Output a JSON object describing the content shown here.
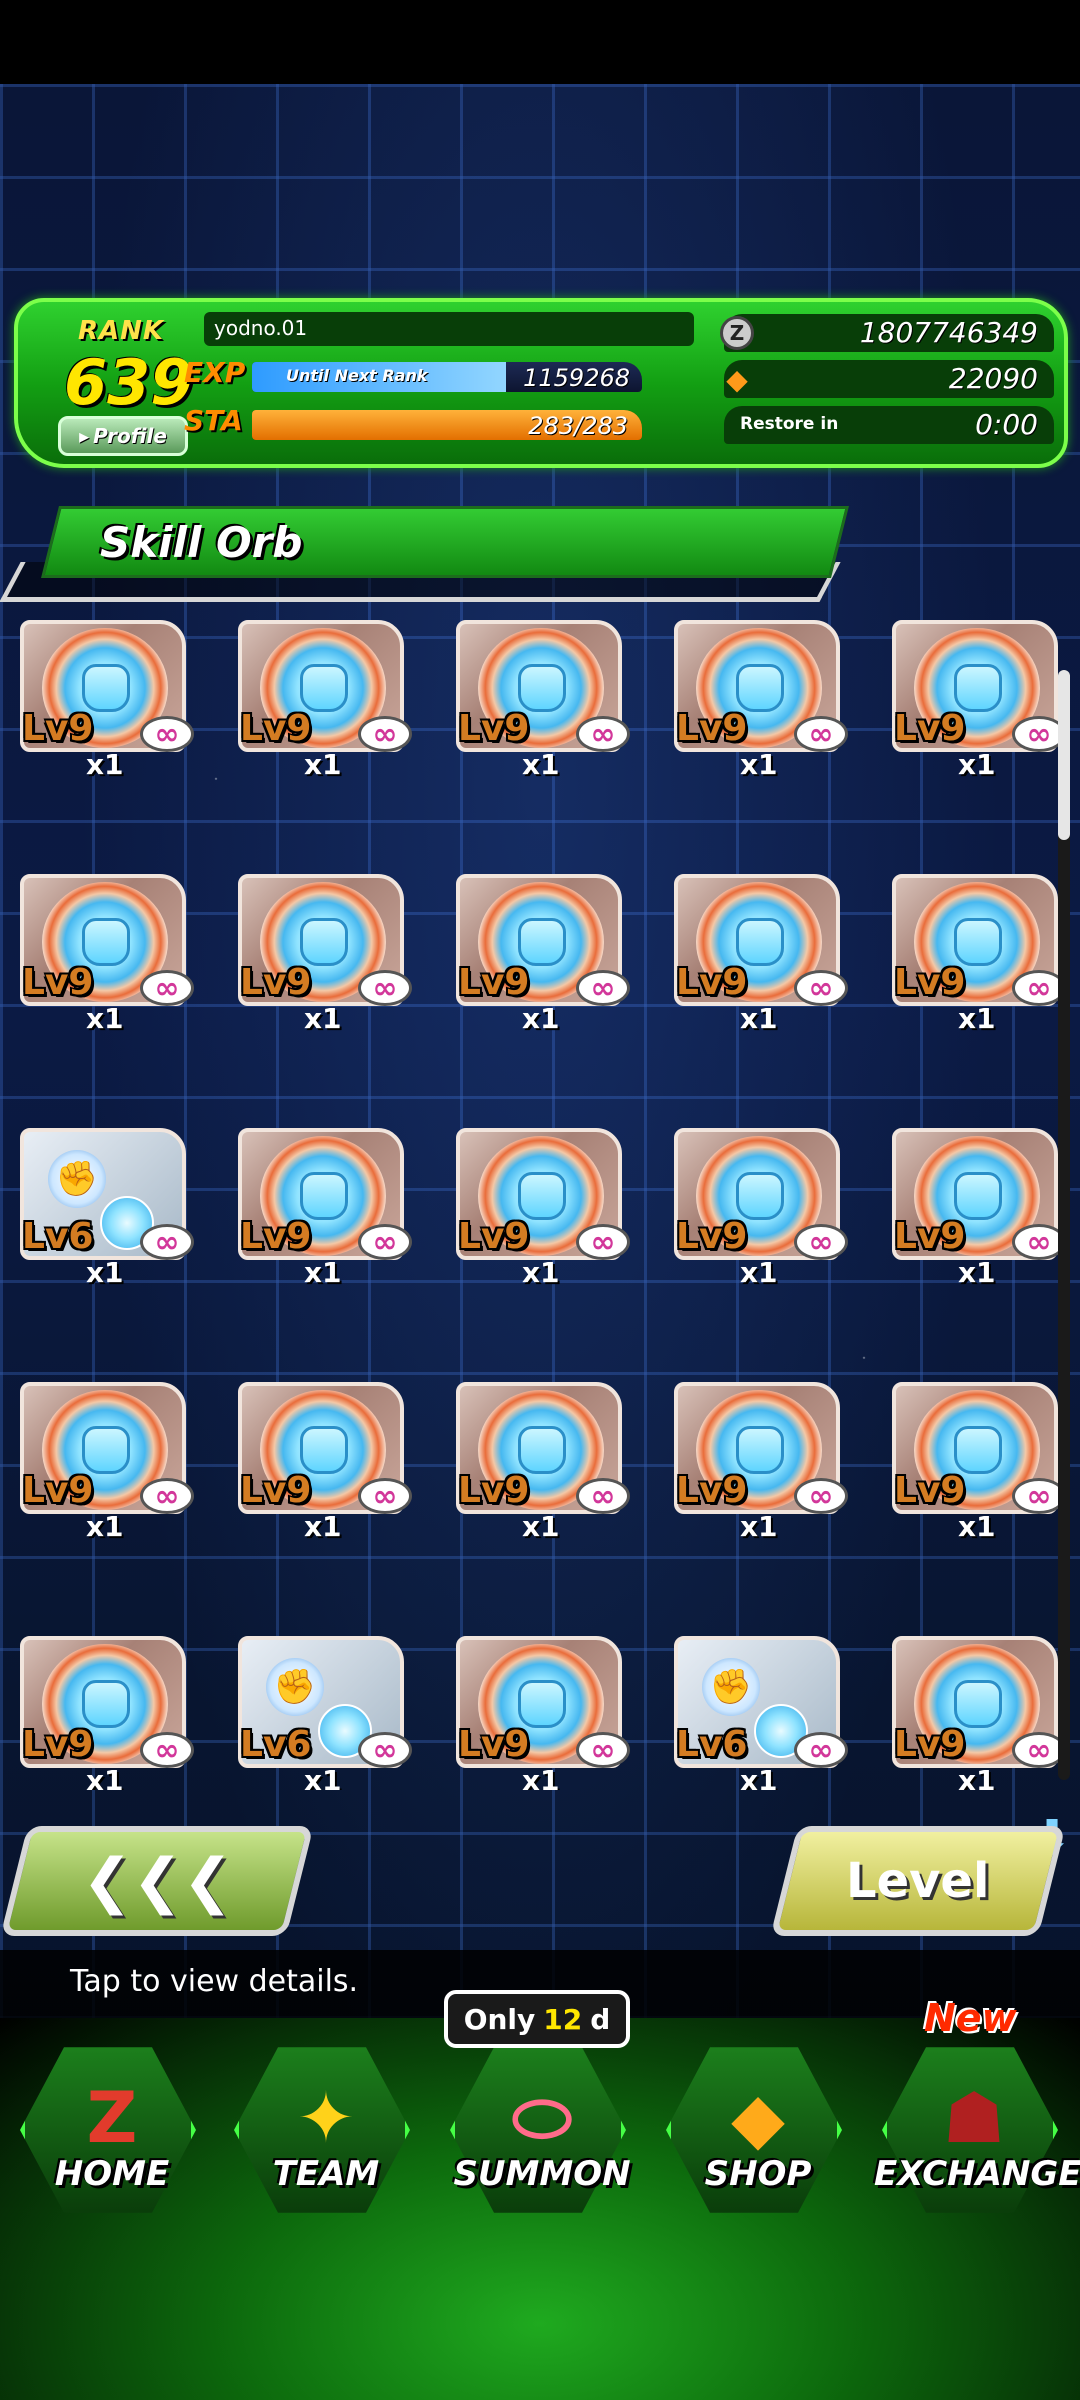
{
  "player": {
    "rank_label": "RANK",
    "rank": "639",
    "name": "yodno.01",
    "profile_label": "Profile",
    "exp_label": "EXP",
    "exp_caption": "Until Next Rank",
    "exp_value": "1159268",
    "exp_progress": 0.65,
    "sta_label": "STA",
    "sta_value": "283/283",
    "sta_progress": 1.0,
    "zeni": "1807746349",
    "dragon_stones": "22090",
    "restore_label": "Restore in",
    "restore_time": "0:00",
    "zeni_icon": "Z"
  },
  "section": {
    "title": "Skill Orb"
  },
  "orbs": [
    {
      "level": "Lv9",
      "qty": "x1",
      "type": "defense"
    },
    {
      "level": "Lv9",
      "qty": "x1",
      "type": "defense"
    },
    {
      "level": "Lv9",
      "qty": "x1",
      "type": "defense"
    },
    {
      "level": "Lv9",
      "qty": "x1",
      "type": "defense"
    },
    {
      "level": "Lv9",
      "qty": "x1",
      "type": "defense"
    },
    {
      "level": "Lv9",
      "qty": "x1",
      "type": "defense"
    },
    {
      "level": "Lv9",
      "qty": "x1",
      "type": "defense"
    },
    {
      "level": "Lv9",
      "qty": "x1",
      "type": "defense"
    },
    {
      "level": "Lv9",
      "qty": "x1",
      "type": "defense"
    },
    {
      "level": "Lv9",
      "qty": "x1",
      "type": "defense"
    },
    {
      "level": "Lv6",
      "qty": "x1",
      "type": "attack"
    },
    {
      "level": "Lv9",
      "qty": "x1",
      "type": "defense"
    },
    {
      "level": "Lv9",
      "qty": "x1",
      "type": "defense"
    },
    {
      "level": "Lv9",
      "qty": "x1",
      "type": "defense"
    },
    {
      "level": "Lv9",
      "qty": "x1",
      "type": "defense"
    },
    {
      "level": "Lv9",
      "qty": "x1",
      "type": "defense"
    },
    {
      "level": "Lv9",
      "qty": "x1",
      "type": "defense"
    },
    {
      "level": "Lv9",
      "qty": "x1",
      "type": "defense"
    },
    {
      "level": "Lv9",
      "qty": "x1",
      "type": "defense"
    },
    {
      "level": "Lv9",
      "qty": "x1",
      "type": "defense"
    },
    {
      "level": "Lv9",
      "qty": "x1",
      "type": "defense"
    },
    {
      "level": "Lv6",
      "qty": "x1",
      "type": "attack"
    },
    {
      "level": "Lv9",
      "qty": "x1",
      "type": "defense"
    },
    {
      "level": "Lv6",
      "qty": "x1",
      "type": "attack"
    },
    {
      "level": "Lv9",
      "qty": "x1",
      "type": "defense"
    }
  ],
  "buttons": {
    "back_icon": "back-chevrons-icon",
    "back_glyph": "❮❮❮",
    "level_label": "Level"
  },
  "tip": "Tap to view details.",
  "nav": {
    "home": "HOME",
    "team": "TEAM",
    "summon": "SUMMON",
    "shop": "SHOP",
    "exchange": "EXCHANGE",
    "summon_badge_only": "Only",
    "summon_badge_num": "12",
    "summon_badge_unit": "d",
    "exchange_badge": "New"
  },
  "colors": {
    "accent_green": "#2fd12f",
    "level_orange": "#d47c22",
    "grid_blue": "#508cff"
  }
}
